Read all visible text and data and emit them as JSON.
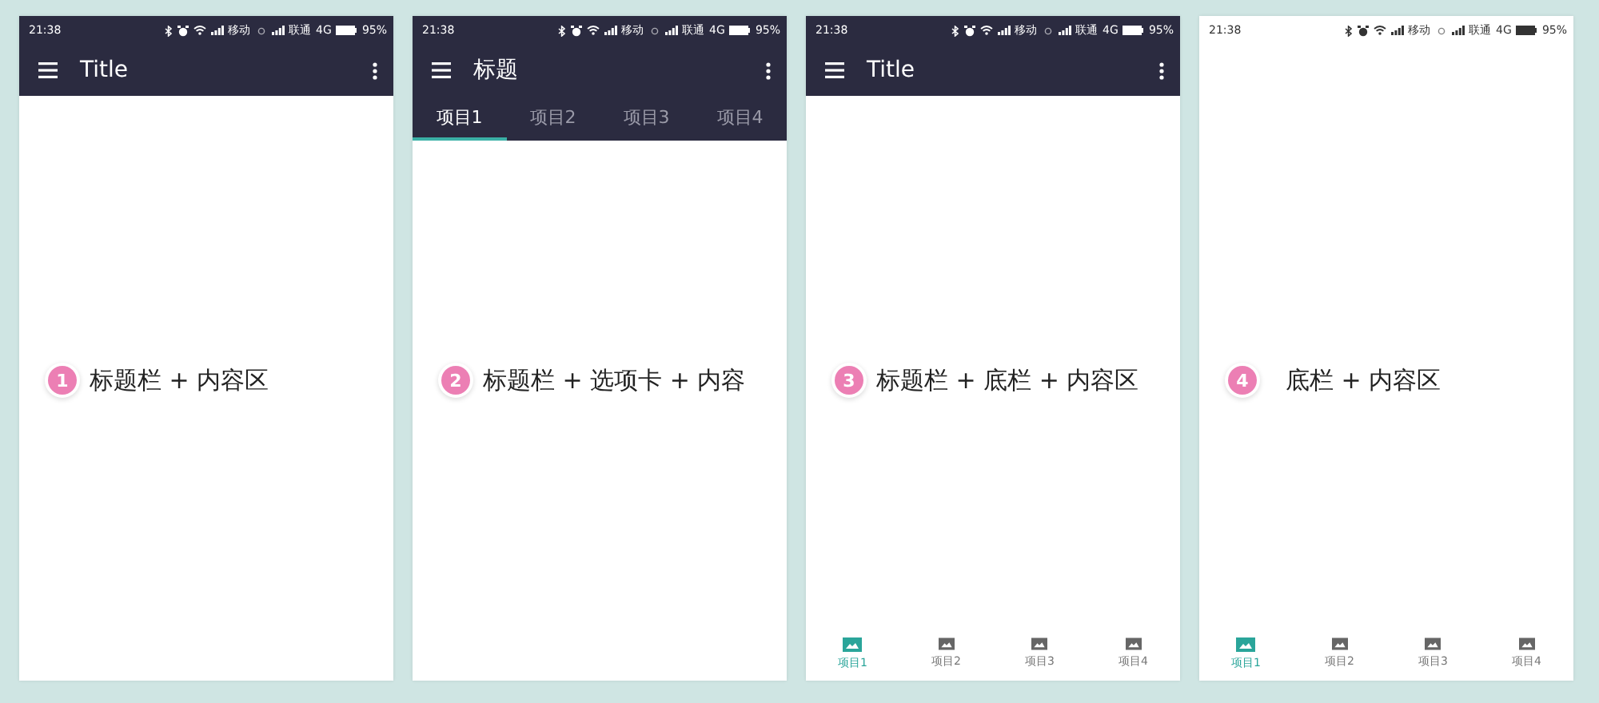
{
  "phones": [
    {
      "status": {
        "dark": true,
        "time": "21:38",
        "carrier_1": "移动",
        "carrier_2": "联通",
        "network": "4G",
        "battery": "95%"
      },
      "app_bar": {
        "title": "Title"
      },
      "caption": {
        "number": "1",
        "text": "标题栏 + 内容区"
      }
    },
    {
      "status": {
        "dark": true,
        "time": "21:38",
        "carrier_1": "移动",
        "carrier_2": "联通",
        "network": "4G",
        "battery": "95%"
      },
      "app_bar": {
        "title": "标题"
      },
      "tabs": [
        {
          "label": "项目1",
          "selected": true
        },
        {
          "label": "项目2",
          "selected": false
        },
        {
          "label": "项目3",
          "selected": false
        },
        {
          "label": "项目4",
          "selected": false
        }
      ],
      "caption": {
        "number": "2",
        "text": "标题栏 + 选项卡 + 内容"
      }
    },
    {
      "status": {
        "dark": true,
        "time": "21:38",
        "carrier_1": "移动",
        "carrier_2": "联通",
        "network": "4G",
        "battery": "95%"
      },
      "app_bar": {
        "title": "Title"
      },
      "caption": {
        "number": "3",
        "text": "标题栏 + 底栏 + 内容区"
      },
      "bottom_nav": [
        {
          "label": "项目1",
          "selected": true
        },
        {
          "label": "项目2",
          "selected": false
        },
        {
          "label": "项目3",
          "selected": false
        },
        {
          "label": "项目4",
          "selected": false
        }
      ]
    },
    {
      "status": {
        "dark": false,
        "time": "21:38",
        "carrier_1": "移动",
        "carrier_2": "联通",
        "network": "4G",
        "battery": "95%"
      },
      "caption": {
        "number": "4",
        "text": "底栏 + 内容区"
      },
      "bottom_nav": [
        {
          "label": "项目1",
          "selected": true
        },
        {
          "label": "项目2",
          "selected": false
        },
        {
          "label": "项目3",
          "selected": false
        },
        {
          "label": "项目4",
          "selected": false
        }
      ]
    }
  ]
}
